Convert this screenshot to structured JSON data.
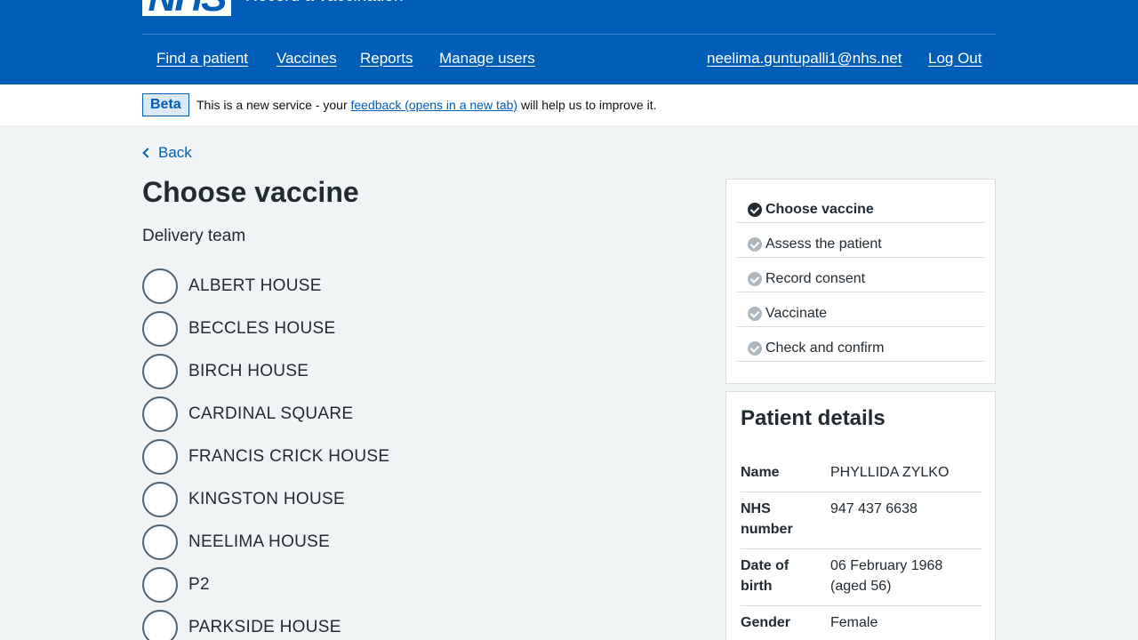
{
  "header": {
    "logo_text": "NHS",
    "service_name": "Record a vaccination",
    "nav": [
      {
        "label": "Find a patient"
      },
      {
        "label": "Vaccines"
      },
      {
        "label": "Reports"
      },
      {
        "label": "Manage users"
      }
    ],
    "user_email": "neelima.guntupalli1@nhs.net",
    "logout_label": "Log Out"
  },
  "beta": {
    "tag": "Beta",
    "text_before": "This is a new service - your ",
    "link_text": "feedback (opens in a new tab)",
    "text_after": " will help us to improve it."
  },
  "back_label": "Back",
  "page_title": "Choose vaccine",
  "legend": "Delivery team",
  "delivery_teams": [
    "ALBERT HOUSE",
    "BECCLES HOUSE",
    "BIRCH HOUSE",
    "CARDINAL SQUARE",
    "FRANCIS CRICK HOUSE",
    "KINGSTON HOUSE",
    "NEELIMA HOUSE",
    "P2",
    "PARKSIDE HOUSE"
  ],
  "steps": [
    {
      "label": "Choose vaccine",
      "status": "current"
    },
    {
      "label": "Assess the patient",
      "status": "pending"
    },
    {
      "label": "Record consent",
      "status": "pending"
    },
    {
      "label": "Vaccinate",
      "status": "pending"
    },
    {
      "label": "Check and confirm",
      "status": "pending"
    }
  ],
  "patient": {
    "title": "Patient details",
    "rows": [
      {
        "key": "Name",
        "value": "PHYLLIDA ZYLKO"
      },
      {
        "key": "NHS number",
        "value": "947 437 6638"
      },
      {
        "key": "Date of birth",
        "value": "06 February 1968 (aged 56)"
      },
      {
        "key": "Gender",
        "value": "Female"
      }
    ]
  },
  "colors": {
    "brand_blue": "#005eb8",
    "page_bg": "#f0f4f5",
    "text": "#212b32",
    "border": "#d8dde0"
  }
}
